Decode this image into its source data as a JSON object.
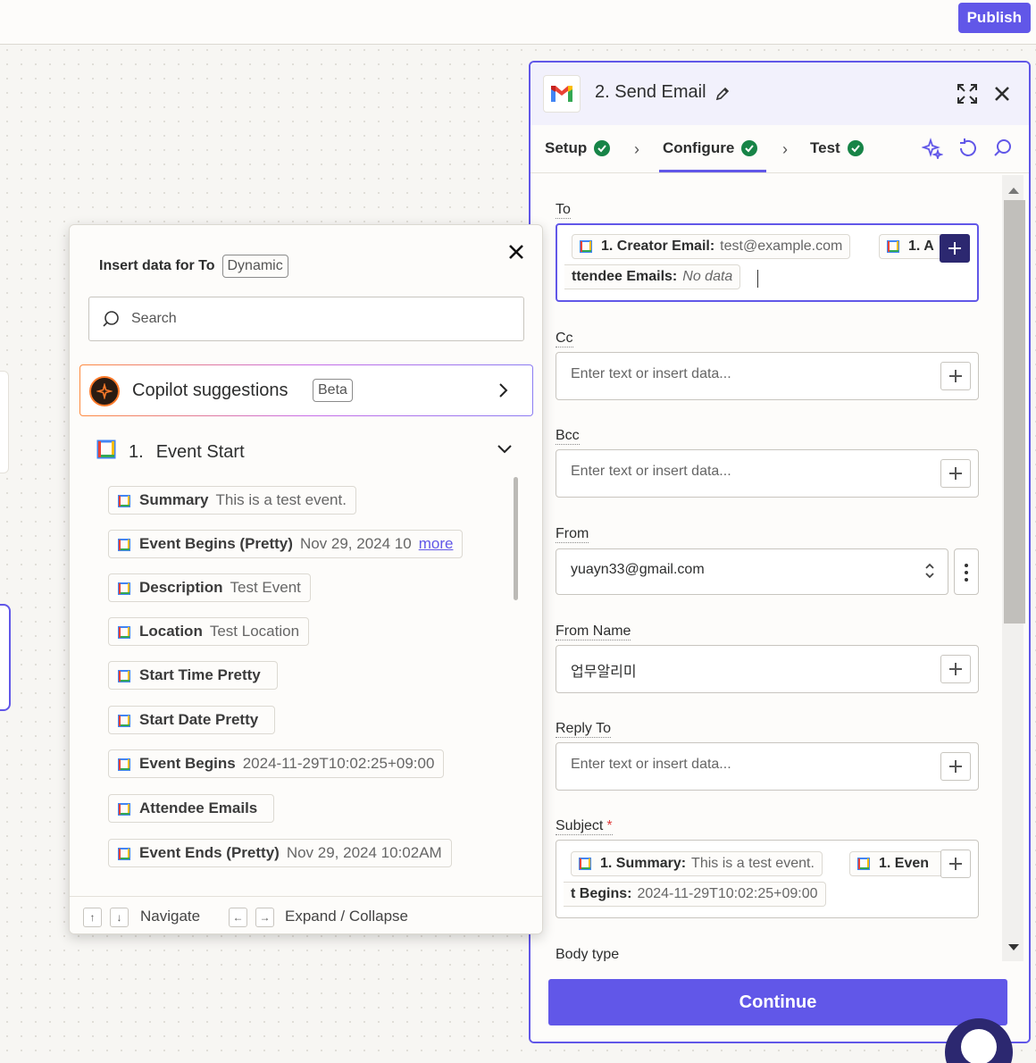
{
  "topbar": {
    "publish_label": "Publish"
  },
  "panel": {
    "step_number": "2.",
    "title": "Send Email",
    "steps": {
      "setup": "Setup",
      "configure": "Configure",
      "test": "Test"
    },
    "fields": {
      "to": {
        "label": "To",
        "pill1_key": "1. Creator Email:",
        "pill1_val": "test@example.com",
        "pill2_key_start": "1. A",
        "pill2_key_end": "ttendee Emails:",
        "pill2_val": "No data"
      },
      "cc": {
        "label": "Cc",
        "placeholder": "Enter text or insert data..."
      },
      "bcc": {
        "label": "Bcc",
        "placeholder": "Enter text or insert data..."
      },
      "from": {
        "label": "From",
        "value": "yuayn33@gmail.com"
      },
      "from_name": {
        "label": "From Name",
        "value": "업무알리미"
      },
      "reply_to": {
        "label": "Reply To",
        "placeholder": "Enter text or insert data..."
      },
      "subject": {
        "label": "Subject",
        "required_mark": "*",
        "pill1_key": "1. Summary:",
        "pill1_val": "This is a test event.",
        "pill2_key_start": "1. Even",
        "pill2_key_end": "t Begins:",
        "pill2_val": "2024-11-29T10:02:25+09:00"
      },
      "body_type": {
        "label": "Body type"
      }
    },
    "continue_label": "Continue"
  },
  "popover": {
    "title": "Insert data for To",
    "badge": "Dynamic",
    "search_placeholder": "Search",
    "copilot_label": "Copilot suggestions",
    "copilot_badge": "Beta",
    "section_number": "1.",
    "section_title": "Event Start",
    "items": [
      {
        "key": "Summary",
        "val": "This is a test event.",
        "more": ""
      },
      {
        "key": "Event Begins (Pretty)",
        "val": "Nov 29, 2024 10",
        "more": "more"
      },
      {
        "key": "Description",
        "val": "Test Event",
        "more": ""
      },
      {
        "key": "Location",
        "val": "Test Location",
        "more": ""
      },
      {
        "key": "Start Time Pretty",
        "val": "",
        "more": ""
      },
      {
        "key": "Start Date Pretty",
        "val": "",
        "more": ""
      },
      {
        "key": "Event Begins",
        "val": "2024-11-29T10:02:25+09:00",
        "more": ""
      },
      {
        "key": "Attendee Emails",
        "val": "",
        "more": ""
      },
      {
        "key": "Event Ends (Pretty)",
        "val": "Nov 29, 2024 10:02AM",
        "more": ""
      }
    ],
    "footer": {
      "navigate": "Navigate",
      "expand": "Expand / Collapse",
      "key_up": "↑",
      "key_down": "↓",
      "key_left": "←",
      "key_right": "→"
    }
  },
  "colors": {
    "accent": "#6157e8",
    "dark_accent": "#2c2870",
    "success": "#178447"
  }
}
